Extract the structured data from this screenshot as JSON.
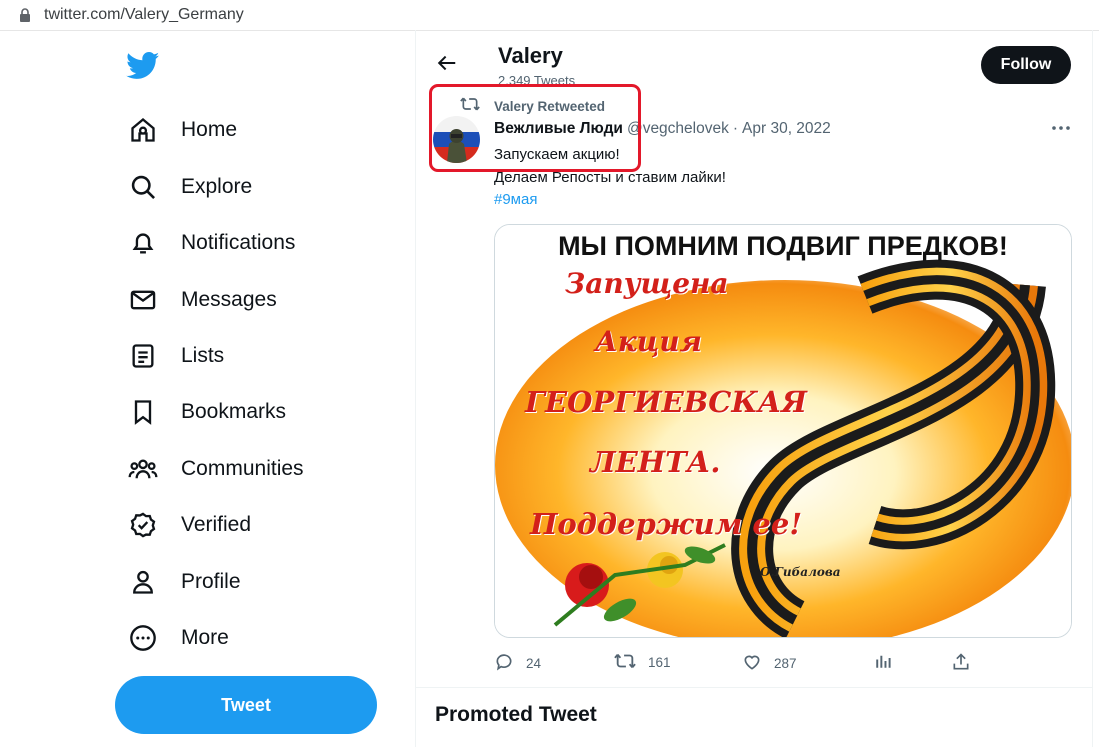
{
  "browser": {
    "url": "twitter.com/Valery_Germany"
  },
  "nav": {
    "items": [
      {
        "label": "Home",
        "icon": "home-icon"
      },
      {
        "label": "Explore",
        "icon": "search-icon"
      },
      {
        "label": "Notifications",
        "icon": "bell-icon"
      },
      {
        "label": "Messages",
        "icon": "envelope-icon"
      },
      {
        "label": "Lists",
        "icon": "list-icon"
      },
      {
        "label": "Bookmarks",
        "icon": "bookmark-icon"
      },
      {
        "label": "Communities",
        "icon": "people-icon"
      },
      {
        "label": "Verified",
        "icon": "verified-badge-icon"
      },
      {
        "label": "Profile",
        "icon": "person-icon"
      },
      {
        "label": "More",
        "icon": "more-circle-icon"
      }
    ],
    "tweet_button": "Tweet"
  },
  "header": {
    "name": "Valery",
    "tweet_count": "2,349 Tweets",
    "follow_label": "Follow"
  },
  "tweet": {
    "retweeted_by": "Valery Retweeted",
    "author_name": "Вежливые Люди",
    "author_handle": "@vegchelovek",
    "separator": "·",
    "date": "Apr 30, 2022",
    "text_line1": "Запускаем акцию!",
    "text_line2": "Делаем Репосты и ставим лайки!",
    "hashtag": "#9мая",
    "image": {
      "headline": "МЫ ПОМНИМ ПОДВИГ ПРЕДКОВ!",
      "lines": [
        "Запущена",
        "Акция",
        "ГЕОРГИЕВСКАЯ",
        "ЛЕНТА.",
        "Поддержим ее!"
      ],
      "signature": "О.Гибалова"
    },
    "stats": {
      "replies": "24",
      "retweets": "161",
      "likes": "287"
    }
  },
  "promoted": {
    "title": "Promoted Tweet"
  },
  "colors": {
    "accent": "#1d9bf0",
    "text": "#0f1419",
    "muted": "#536471",
    "highlight": "#e3182a"
  }
}
